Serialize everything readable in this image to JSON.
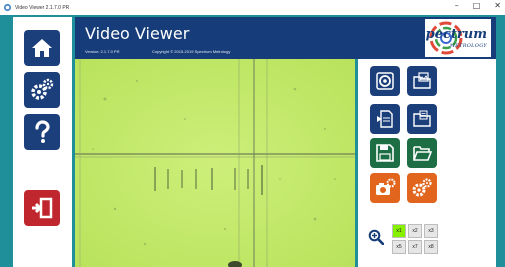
{
  "window": {
    "title": "Video Viewer 2.1.7.0 PR",
    "controls": {
      "minimize": "–",
      "maximize": "□",
      "close": "✕"
    }
  },
  "header": {
    "app_title": "Video Viewer",
    "version": "Version: 2.1.7.0 PR",
    "copyright": "Copyright ©  2015-2019  Spectrum Metrology"
  },
  "logo": {
    "wordmark": "Spectrum",
    "tagline": "METROLOGY"
  },
  "sidebar": {
    "items": [
      {
        "name": "home",
        "icon": "home-icon"
      },
      {
        "name": "settings",
        "icon": "gears-icon"
      },
      {
        "name": "help",
        "icon": "question-icon"
      },
      {
        "name": "exit",
        "icon": "exit-icon"
      }
    ]
  },
  "tools": [
    {
      "name": "camera-view",
      "icon": "lens-icon",
      "color": "navy"
    },
    {
      "name": "open-image",
      "icon": "image-folder-icon",
      "color": "navy"
    },
    {
      "name": "load-file",
      "icon": "document-icon",
      "color": "navy"
    },
    {
      "name": "open-folder",
      "icon": "folder-icon",
      "color": "navy"
    },
    {
      "name": "save",
      "icon": "save-icon",
      "color": "green"
    },
    {
      "name": "open-folder-2",
      "icon": "folder-open-icon",
      "color": "green"
    },
    {
      "name": "camera-settings",
      "icon": "camera-gear-icon",
      "color": "orange"
    },
    {
      "name": "settings",
      "icon": "gears-icon",
      "color": "orange"
    }
  ],
  "zoom": {
    "levels": [
      "x1",
      "x2",
      "x3",
      "x5",
      "x7",
      "x8"
    ],
    "selected": "x1"
  },
  "colors": {
    "frame": "#1f8f9a",
    "navy": "#1b3f7a",
    "header": "#163d7a",
    "red": "#c0262d",
    "green": "#1d6e45",
    "orange": "#e2651d",
    "viewer_bg": "#c7ec6e",
    "zoom_active": "#86f000"
  }
}
